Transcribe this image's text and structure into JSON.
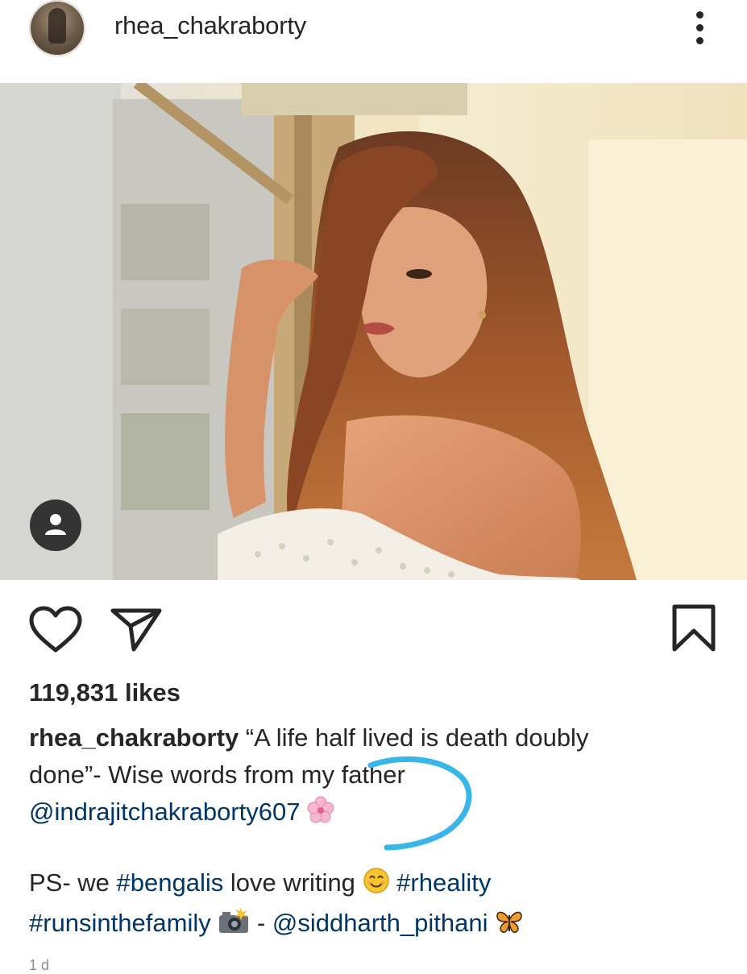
{
  "post": {
    "username": "rhea_chakraborty",
    "likes": "119,831 likes",
    "caption": {
      "username": "rhea_chakraborty",
      "line1": " “A life half lived is death doubly",
      "line2": "done”- Wise words from my father",
      "mention_father": "@indrajitchakraborty607",
      "ps_prefix": "PS- we ",
      "hashtag_bengalis": "#bengalis",
      "ps_middle": " love writing ",
      "hashtag_rheality": "#rheality",
      "hashtag_runsinthefamily": "#runsinthefamily",
      "dash": " - ",
      "mention_photographer": "@siddharth_pithani"
    },
    "timestamp": "1 d"
  },
  "icons": {
    "more": "more-options-icon",
    "user_tag": "user-tag-icon",
    "like": "heart-icon",
    "share": "send-icon",
    "save": "bookmark-icon",
    "blossom": "cherry-blossom-icon",
    "smile": "smiling-face-icon",
    "camera": "camera-flash-icon",
    "butterfly": "butterfly-icon"
  },
  "colors": {
    "text": "#262626",
    "link": "#003569",
    "annotation": "#39b6e8"
  }
}
